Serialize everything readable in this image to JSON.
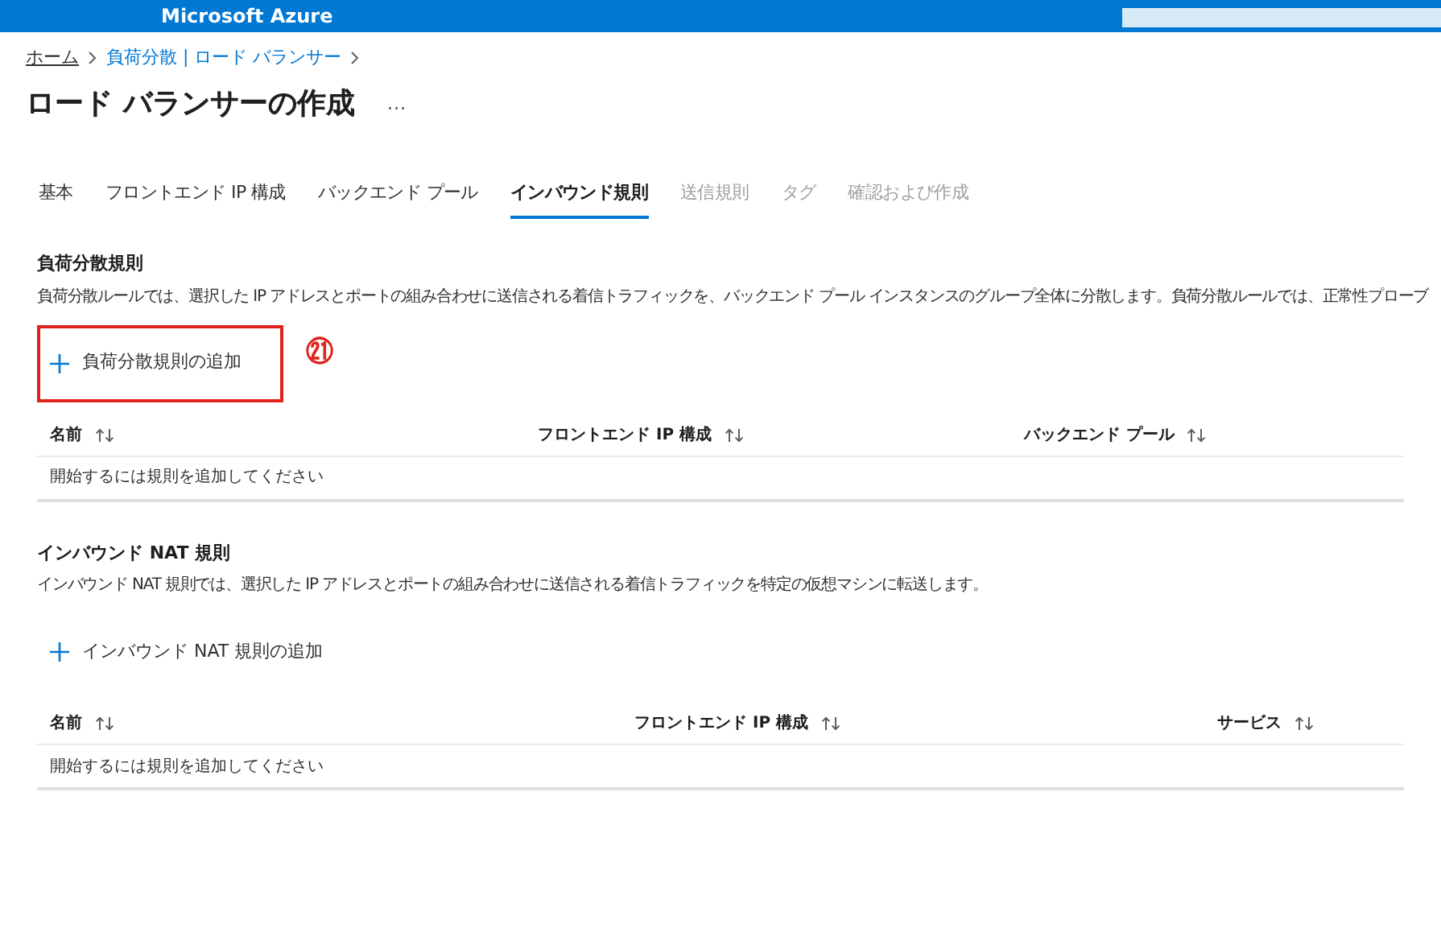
{
  "header": {
    "brand": "Microsoft Azure"
  },
  "breadcrumb": [
    {
      "label": "ホーム"
    },
    {
      "label": "負荷分散 | ロード バランサー"
    }
  ],
  "page_title": "ロード バランサーの作成",
  "more": "…",
  "tabs": [
    {
      "label": "基本",
      "selected": false,
      "disabled": false
    },
    {
      "label": "フロントエンド IP 構成",
      "selected": false,
      "disabled": false
    },
    {
      "label": "バックエンド プール",
      "selected": false,
      "disabled": false
    },
    {
      "label": "インバウンド規則",
      "selected": true,
      "disabled": false
    },
    {
      "label": "送信規則",
      "selected": false,
      "disabled": true
    },
    {
      "label": "タグ",
      "selected": false,
      "disabled": true
    },
    {
      "label": "確認および作成",
      "selected": false,
      "disabled": true
    }
  ],
  "sections": [
    {
      "heading": "負荷分散規則",
      "description": "負荷分散ルールでは、選択した IP アドレスとポートの組み合わせに送信される着信トラフィックを、バックエンド プール インスタンスのグループ全体に分散します。負荷分散ルールでは、正常性プローブ",
      "add_button": "負荷分散規則の追加",
      "highlighted": true,
      "annotation": "㉑",
      "columns": [
        "名前",
        "フロントエンド IP 構成",
        "バックエンド プール"
      ],
      "empty_message": "開始するには規則を追加してください"
    },
    {
      "heading": "インバウンド NAT 規則",
      "description": "インバウンド NAT 規則では、選択した IP アドレスとポートの組み合わせに送信される着信トラフィックを特定の仮想マシンに転送します。",
      "add_button": "インバウンド NAT 規則の追加",
      "highlighted": false,
      "columns": [
        "名前",
        "フロントエンド IP 構成",
        "サービス"
      ],
      "empty_message": "開始するには規則を追加してください"
    }
  ]
}
